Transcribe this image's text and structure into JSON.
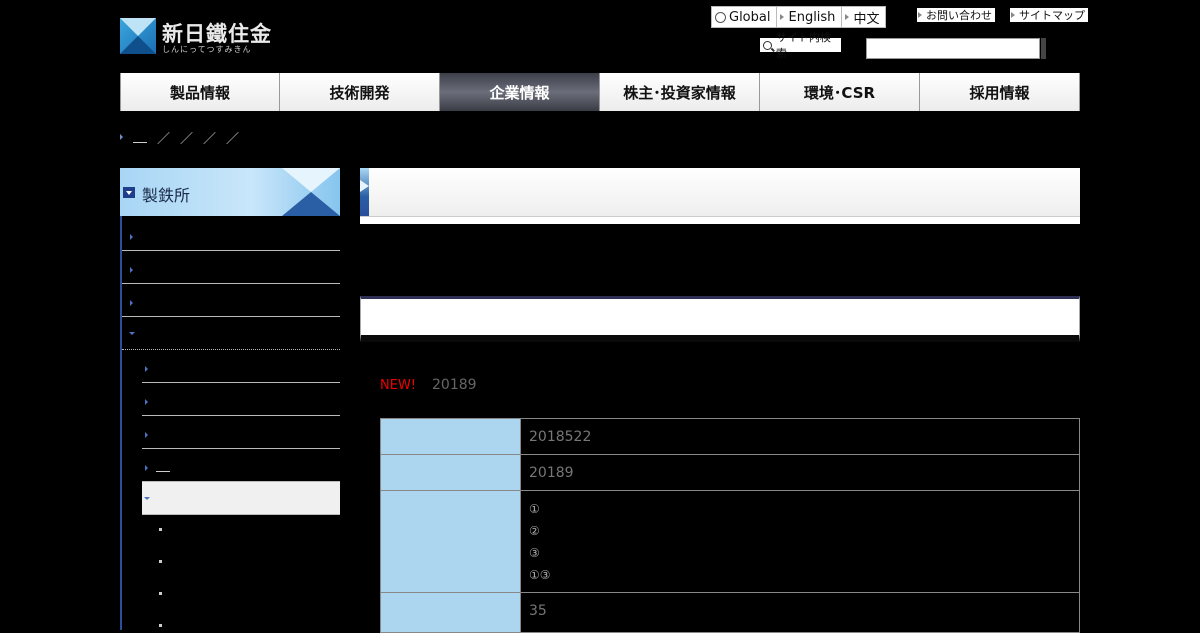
{
  "header": {
    "logo_text": "新日鐵住金",
    "logo_kana": "しんにってつすみきん",
    "lang_links": [
      "Global",
      "English",
      "中文"
    ],
    "contact_label": "お問い合わせ",
    "sitemap_label": "サイトマップ",
    "site_search_label": "サイト内検索",
    "search_value": ""
  },
  "nav": {
    "items": [
      "製品情報",
      "技術開発",
      "企業情報",
      "株主･投資家情報",
      "環境･CSR",
      "採用情報"
    ],
    "active_index": 2
  },
  "sidebar": {
    "heading": "製鉄所"
  },
  "main": {
    "new_badge": "NEW!",
    "date_text": "20189",
    "table": {
      "rows": [
        {
          "value": "2018522"
        },
        {
          "value": "20189"
        },
        {
          "lines": [
            "①",
            "②",
            "③",
            "①③"
          ]
        },
        {
          "value": "35"
        }
      ]
    }
  },
  "colors": {
    "nav_active": "#3c3f4a",
    "accent_blue": "#2a4f9a",
    "table_header": "#acd5ef",
    "new_badge": "#ee0000"
  }
}
